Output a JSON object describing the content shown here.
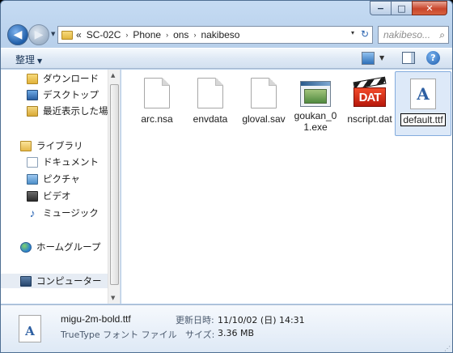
{
  "window": {
    "caption": {
      "minimize": "−",
      "maximize": "□",
      "close": "✕"
    }
  },
  "address": {
    "overflow": "«",
    "crumbs": [
      "SC-02C",
      "Phone",
      "ons",
      "nakibeso"
    ],
    "separator": "›",
    "dropdown": "▾",
    "refresh": "↻"
  },
  "search": {
    "placeholder": "nakibeso..."
  },
  "toolbar": {
    "organize_label": "整理",
    "organize_arrow": "▼",
    "view_arrow": "▼",
    "help": "?"
  },
  "nav": {
    "items": [
      {
        "label": "ダウンロード",
        "icon": "download-folder-icon"
      },
      {
        "label": "デスクトップ",
        "icon": "desktop-icon"
      },
      {
        "label": "最近表示した場所",
        "icon": "recent-places-icon"
      },
      {
        "label": "ライブラリ",
        "icon": "library-icon"
      },
      {
        "label": "ドキュメント",
        "icon": "documents-icon"
      },
      {
        "label": "ピクチャ",
        "icon": "pictures-icon"
      },
      {
        "label": "ビデオ",
        "icon": "videos-icon"
      },
      {
        "label": "ミュージック",
        "icon": "music-icon"
      },
      {
        "label": "ホームグループ",
        "icon": "homegroup-icon"
      },
      {
        "label": "コンピューター",
        "icon": "computer-icon"
      }
    ],
    "scroll_up": "▲",
    "scroll_down": "▼"
  },
  "files": [
    {
      "name": "arc.nsa",
      "type": "blank"
    },
    {
      "name": "envdata",
      "type": "blank"
    },
    {
      "name": "gloval.sav",
      "type": "blank"
    },
    {
      "name": "goukan_01.exe",
      "type": "exe"
    },
    {
      "name": "nscript.dat",
      "type": "dat",
      "icon_text": "DAT"
    },
    {
      "name": "default.ttf",
      "type": "ttf",
      "icon_text": "A",
      "renaming": true
    }
  ],
  "details": {
    "file_name": "migu-2m-bold.ttf",
    "file_type": "TrueType フォント ファイル",
    "modified_label": "更新日時:",
    "modified_value": "11/10/02 (日) 14:31",
    "size_label": "サイズ:",
    "size_value": "3.36 MB",
    "icon_text": "A"
  }
}
